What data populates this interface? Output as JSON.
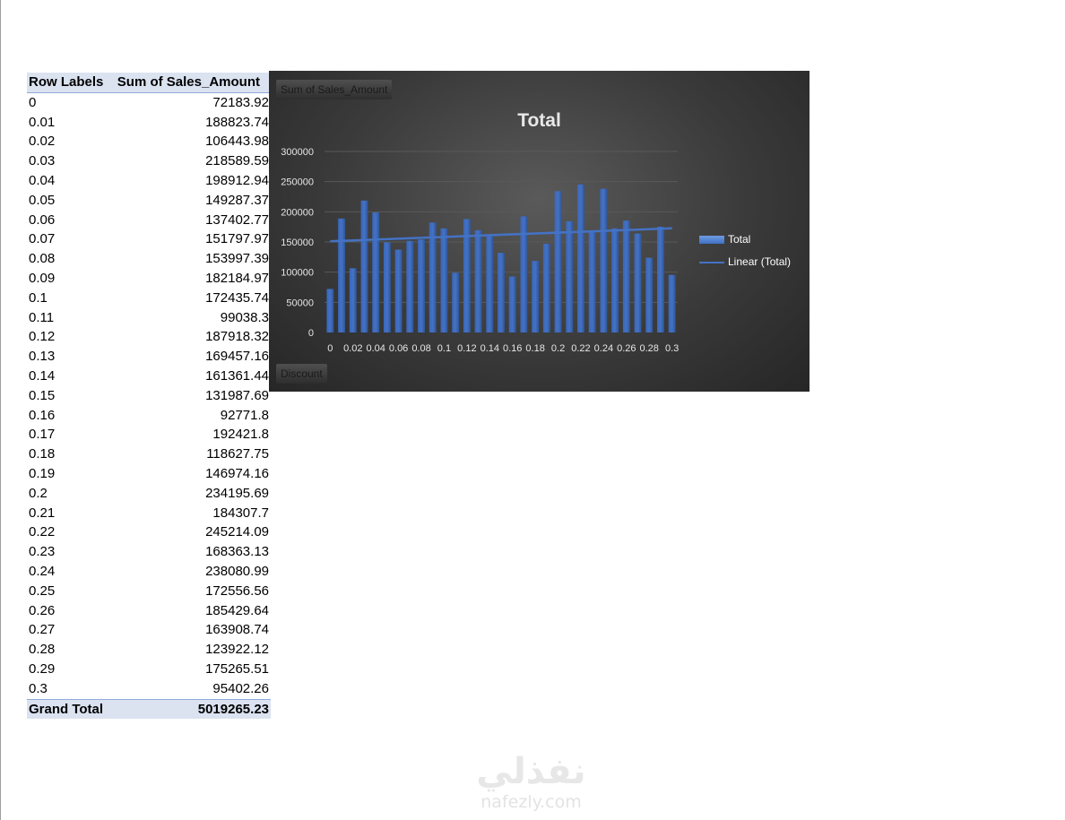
{
  "pivot": {
    "header_row_labels": "Row Labels",
    "header_sum": "Sum of Sales_Amount",
    "rows": [
      {
        "label": "0",
        "value": "72183.92"
      },
      {
        "label": "0.01",
        "value": "188823.74"
      },
      {
        "label": "0.02",
        "value": "106443.98"
      },
      {
        "label": "0.03",
        "value": "218589.59"
      },
      {
        "label": "0.04",
        "value": "198912.94"
      },
      {
        "label": "0.05",
        "value": "149287.37"
      },
      {
        "label": "0.06",
        "value": "137402.77"
      },
      {
        "label": "0.07",
        "value": "151797.97"
      },
      {
        "label": "0.08",
        "value": "153997.39"
      },
      {
        "label": "0.09",
        "value": "182184.97"
      },
      {
        "label": "0.1",
        "value": "172435.74"
      },
      {
        "label": "0.11",
        "value": "99038.3"
      },
      {
        "label": "0.12",
        "value": "187918.32"
      },
      {
        "label": "0.13",
        "value": "169457.16"
      },
      {
        "label": "0.14",
        "value": "161361.44"
      },
      {
        "label": "0.15",
        "value": "131987.69"
      },
      {
        "label": "0.16",
        "value": "92771.8"
      },
      {
        "label": "0.17",
        "value": "192421.8"
      },
      {
        "label": "0.18",
        "value": "118627.75"
      },
      {
        "label": "0.19",
        "value": "146974.16"
      },
      {
        "label": "0.2",
        "value": "234195.69"
      },
      {
        "label": "0.21",
        "value": "184307.7"
      },
      {
        "label": "0.22",
        "value": "245214.09"
      },
      {
        "label": "0.23",
        "value": "168363.13"
      },
      {
        "label": "0.24",
        "value": "238080.99"
      },
      {
        "label": "0.25",
        "value": "172556.56"
      },
      {
        "label": "0.26",
        "value": "185429.64"
      },
      {
        "label": "0.27",
        "value": "163908.74"
      },
      {
        "label": "0.28",
        "value": "123922.12"
      },
      {
        "label": "0.29",
        "value": "175265.51"
      },
      {
        "label": "0.3",
        "value": "95402.26"
      }
    ],
    "grand_total_label": "Grand Total",
    "grand_total_value": "5019265.23"
  },
  "chart_buttons": {
    "value_field": "Sum of Sales_Amount",
    "axis_field": "Discount"
  },
  "chart_data": {
    "type": "bar",
    "title": "Total",
    "xlabel": "",
    "ylabel": "",
    "categories": [
      "0",
      "0.01",
      "0.02",
      "0.03",
      "0.04",
      "0.05",
      "0.06",
      "0.07",
      "0.08",
      "0.09",
      "0.1",
      "0.11",
      "0.12",
      "0.13",
      "0.14",
      "0.15",
      "0.16",
      "0.17",
      "0.18",
      "0.19",
      "0.2",
      "0.21",
      "0.22",
      "0.23",
      "0.24",
      "0.25",
      "0.26",
      "0.27",
      "0.28",
      "0.29",
      "0.3"
    ],
    "x_tick_labels_shown": [
      "0",
      "0.02",
      "0.04",
      "0.06",
      "0.08",
      "0.1",
      "0.12",
      "0.14",
      "0.16",
      "0.18",
      "0.2",
      "0.22",
      "0.24",
      "0.26",
      "0.28",
      "0.3"
    ],
    "series": [
      {
        "name": "Total",
        "values": [
          72183.92,
          188823.74,
          106443.98,
          218589.59,
          198912.94,
          149287.37,
          137402.77,
          151797.97,
          153997.39,
          182184.97,
          172435.74,
          99038.3,
          187918.32,
          169457.16,
          161361.44,
          131987.69,
          92771.8,
          192421.8,
          118627.75,
          146974.16,
          234195.69,
          184307.7,
          245214.09,
          168363.13,
          238080.99,
          172556.56,
          185429.64,
          163908.74,
          123922.12,
          175265.51,
          95402.26
        ]
      }
    ],
    "trendline": {
      "name": "Linear (Total)",
      "type": "linear"
    },
    "ylim": [
      0,
      300000
    ],
    "yticks": [
      0,
      50000,
      100000,
      150000,
      200000,
      250000,
      300000
    ],
    "grid": true,
    "legend_position": "right",
    "colors": {
      "bar": "#4472c4",
      "trend": "#4472c4",
      "background": "#404040",
      "text": "#ffffff"
    }
  },
  "watermark": {
    "arabic": "نفذلي",
    "latin": "nafezly.com"
  }
}
